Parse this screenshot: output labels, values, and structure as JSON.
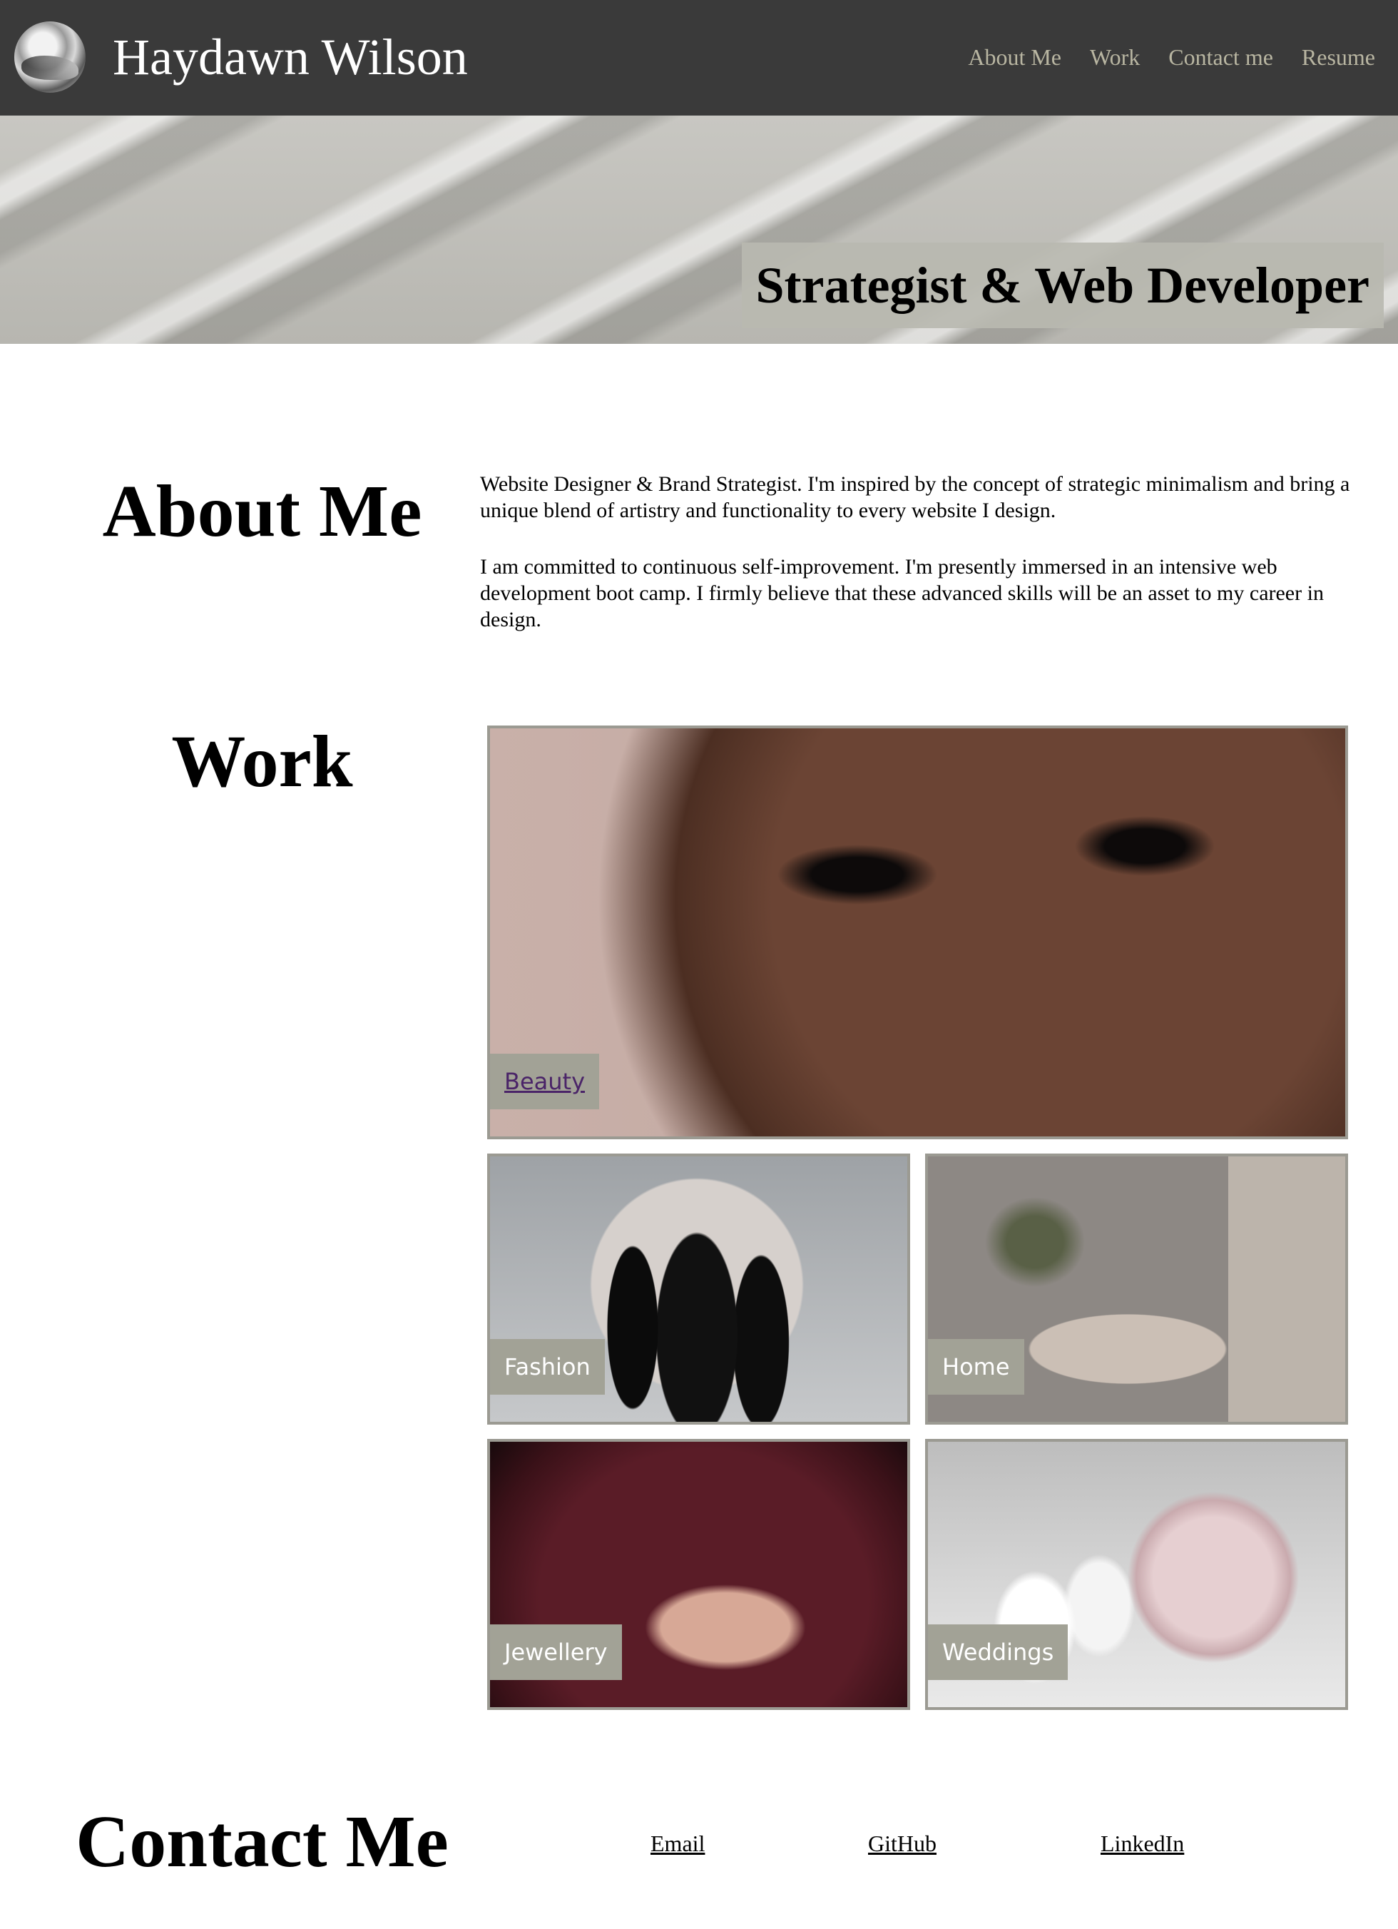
{
  "header": {
    "site_name": "Haydawn Wilson",
    "nav": [
      "About Me",
      "Work",
      "Contact me",
      "Resume"
    ]
  },
  "hero": {
    "title": "Strategist & Web Developer"
  },
  "about": {
    "heading": "About Me",
    "paragraphs": [
      "Website Designer & Brand Strategist. I'm inspired by the concept of strategic minimalism and bring a unique blend of artistry and functionality to every website I design.",
      "I am committed to continuous self-improvement. I'm presently immersed in an intensive web development boot camp. I firmly believe that these advanced skills will be an asset to my career in design."
    ]
  },
  "work": {
    "heading": "Work",
    "items": [
      "Beauty",
      "Fashion",
      "Home",
      "Jewellery",
      "Weddings"
    ]
  },
  "contact": {
    "heading": "Contact Me",
    "links": [
      "Email",
      "GitHub",
      "LinkedIn"
    ]
  },
  "colors": {
    "header_bg": "#3a3a3a",
    "nav_text": "#b9b6a2",
    "label_bg": "#a2a296",
    "visited_link": "#4a2468"
  }
}
